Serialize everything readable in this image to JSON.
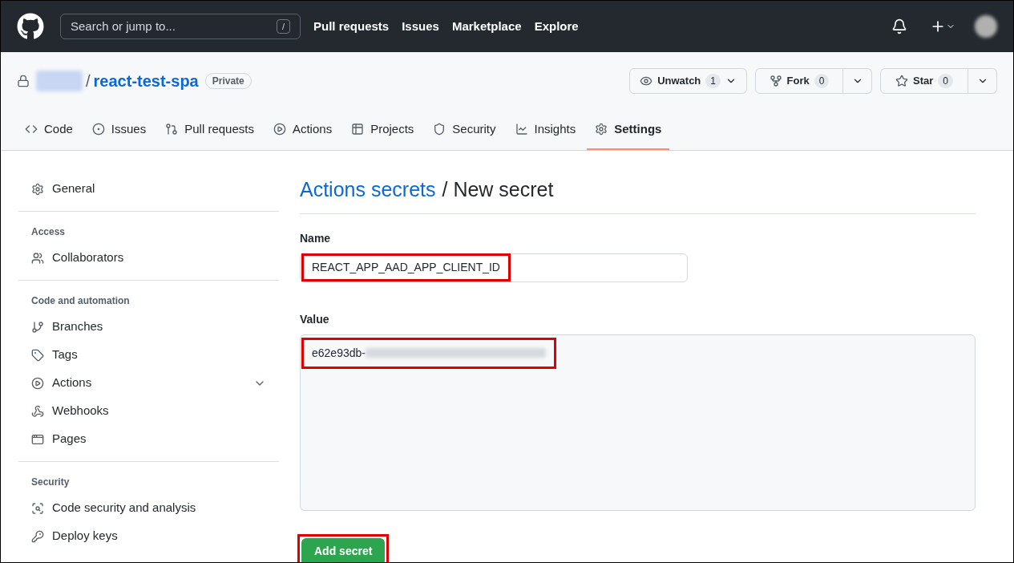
{
  "header": {
    "search_placeholder": "Search or jump to...",
    "search_key": "/",
    "nav": [
      "Pull requests",
      "Issues",
      "Marketplace",
      "Explore"
    ]
  },
  "repo": {
    "separator": "/",
    "name": "react-test-spa",
    "visibility": "Private",
    "actions": [
      {
        "kind": "watch",
        "label": "Unwatch",
        "count": "1"
      },
      {
        "kind": "fork",
        "label": "Fork",
        "count": "0"
      },
      {
        "kind": "star",
        "label": "Star",
        "count": "0"
      }
    ]
  },
  "tabs": [
    {
      "label": "Code",
      "selected": false
    },
    {
      "label": "Issues",
      "selected": false
    },
    {
      "label": "Pull requests",
      "selected": false
    },
    {
      "label": "Actions",
      "selected": false
    },
    {
      "label": "Projects",
      "selected": false
    },
    {
      "label": "Security",
      "selected": false
    },
    {
      "label": "Insights",
      "selected": false
    },
    {
      "label": "Settings",
      "selected": true
    }
  ],
  "sidebar": {
    "sections": [
      {
        "items": [
          {
            "label": "General"
          }
        ]
      },
      {
        "heading": "Access",
        "items": [
          {
            "label": "Collaborators"
          }
        ]
      },
      {
        "heading": "Code and automation",
        "items": [
          {
            "label": "Branches"
          },
          {
            "label": "Tags"
          },
          {
            "label": "Actions",
            "expanded": false
          },
          {
            "label": "Webhooks"
          },
          {
            "label": "Pages"
          }
        ]
      },
      {
        "heading": "Security",
        "items": [
          {
            "label": "Code security and analysis"
          },
          {
            "label": "Deploy keys"
          }
        ]
      }
    ]
  },
  "form": {
    "breadcrumb_link": "Actions secrets",
    "breadcrumb_current": "/ New secret",
    "name_label": "Name",
    "name_value": "REACT_APP_AAD_APP_CLIENT_ID",
    "name_highlighted": true,
    "value_label": "Value",
    "value_value": "e62e93db-",
    "value_highlighted": true,
    "submit": "Add secret",
    "submit_highlighted": true
  }
}
